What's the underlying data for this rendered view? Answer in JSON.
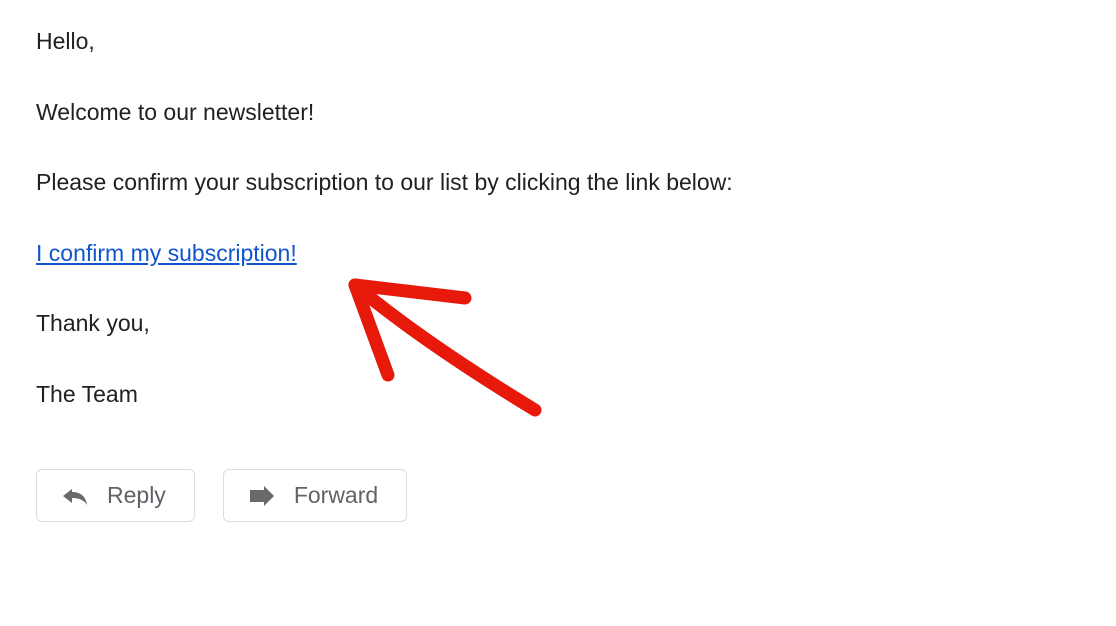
{
  "email": {
    "greeting": "Hello,",
    "welcome": "Welcome to our newsletter!",
    "instruction": "Please confirm your subscription to our list by clicking the link below:",
    "confirm_link_text": "I confirm my subscription!",
    "thanks": "Thank you,",
    "signature": "The Team"
  },
  "actions": {
    "reply_label": "Reply",
    "forward_label": "Forward"
  },
  "annotation": {
    "type": "hand-drawn-arrow",
    "color": "#e6190b",
    "points_to": "confirm-subscription-link"
  }
}
